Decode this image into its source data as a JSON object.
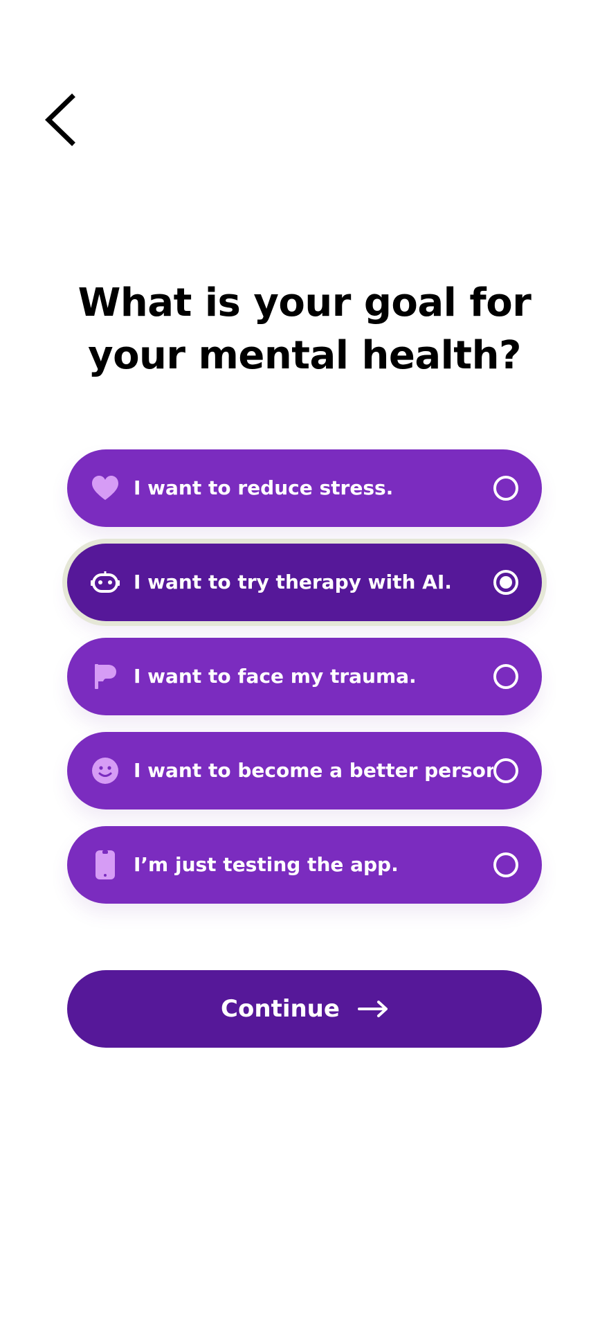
{
  "navigation": {
    "back_icon": "chevron-left-icon"
  },
  "question": {
    "title": "What is your goal for your mental health?"
  },
  "options": [
    {
      "label": "I want to reduce stress.",
      "icon": "heart-icon",
      "selected": false
    },
    {
      "label": "I want to try therapy with AI.",
      "icon": "robot-icon",
      "selected": true
    },
    {
      "label": "I want to face my trauma.",
      "icon": "flag-icon",
      "selected": false
    },
    {
      "label": "I want to become a better person",
      "icon": "smiley-icon",
      "selected": false
    },
    {
      "label": "I’m just testing the app.",
      "icon": "phone-icon",
      "selected": false
    }
  ],
  "continue_button": {
    "label": "Continue",
    "icon": "arrow-right-icon"
  },
  "colors": {
    "option_background": "#7b2cbf",
    "selected_background": "#561899",
    "selected_outline": "#e5e7d7",
    "icon_tint": "#d69cf5",
    "button_background": "#561899",
    "text": "#ffffff",
    "title": "#000000"
  }
}
